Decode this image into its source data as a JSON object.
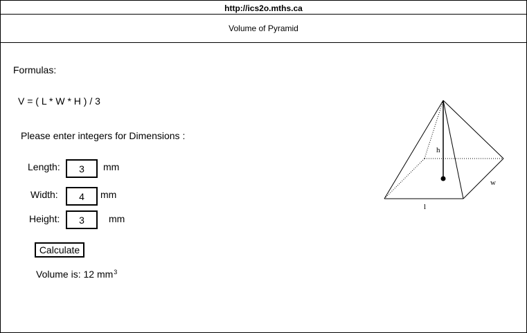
{
  "url": "http://ics2o.mths.ca",
  "page_title": "Volume of Pyramid",
  "formulas_label": "Formulas:",
  "formula": "V = ( L * W * H ) / 3",
  "prompt": "Please enter integers for Dimensions :",
  "length": {
    "label": "Length:",
    "value": "3",
    "unit": "mm"
  },
  "width": {
    "label": "Width:",
    "value": "4",
    "unit": "mm"
  },
  "height": {
    "label": "Height:",
    "value": "3",
    "unit": "mm"
  },
  "calculate_label": "Calculate",
  "result": {
    "prefix": "Volume is: 12 mm",
    "exponent": "3"
  },
  "diagram": {
    "height_label": "h",
    "width_label": "w",
    "length_label": "l"
  }
}
